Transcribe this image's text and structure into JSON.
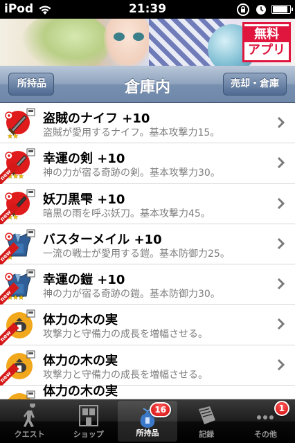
{
  "status_bar": {
    "carrier": "iPod",
    "time": "21:39",
    "battery_level": 0.9
  },
  "banner": {
    "badge_line1": "無料",
    "badge_line2": "アプリ"
  },
  "nav": {
    "back_label": "所持品",
    "title": "倉庫内",
    "right_label": "売却・倉庫"
  },
  "items": [
    {
      "title": "盗賊のナイフ +10",
      "description": "盗賊が愛用するナイフ。基本攻撃力15。",
      "icon": "knife-icon",
      "stars": 2,
      "is_new": false
    },
    {
      "title": "幸運の剣 +10",
      "description": "神の力が宿る奇跡の剣。基本攻撃力30。",
      "icon": "sword-icon",
      "stars": 3,
      "is_new": true
    },
    {
      "title": "妖刀黒雫 +10",
      "description": "暗黒の雨を呼ぶ妖刀。基本攻撃力45。",
      "icon": "katana-icon",
      "stars": 2,
      "is_new": true
    },
    {
      "title": "バスターメイル +10",
      "description": "一流の戦士が愛用する鎧。基本防御力25。",
      "icon": "armor-icon",
      "stars": 1,
      "is_new": true
    },
    {
      "title": "幸運の鎧 +10",
      "description": "神の力が宿る奇跡の鎧。基本防御力30。",
      "icon": "armor-icon",
      "stars": 3,
      "is_new": true
    },
    {
      "title": "体力の木の実",
      "description": "攻撃力と守備力の成長を増幅させる。",
      "icon": "nut-bag-icon",
      "stars": 0,
      "is_new": true
    },
    {
      "title": "体力の木の実",
      "description": "攻撃力と守備力の成長を増幅させる。",
      "icon": "nut-bag-icon",
      "stars": 0,
      "is_new": true
    },
    {
      "title": "体力の木の実",
      "description": "",
      "icon": "nut-bag-icon",
      "stars": 0,
      "is_new": false
    }
  ],
  "new_flag_text": "new",
  "tabs": [
    {
      "label": "クエスト",
      "icon": "quest-icon",
      "selected": false,
      "badge": ""
    },
    {
      "label": "ショップ",
      "icon": "shop-icon",
      "selected": false,
      "badge": ""
    },
    {
      "label": "所持品",
      "icon": "bag-icon",
      "selected": true,
      "badge": "16"
    },
    {
      "label": "記録",
      "icon": "book-icon",
      "selected": false,
      "badge": ""
    },
    {
      "label": "その他",
      "icon": "more-icon",
      "selected": false,
      "badge": "1"
    }
  ],
  "colors": {
    "nav_bar": "#7890b0",
    "badge_red": "#d10c0c",
    "new_flag": "#d51818",
    "desc_gray": "#7d7d7d"
  }
}
